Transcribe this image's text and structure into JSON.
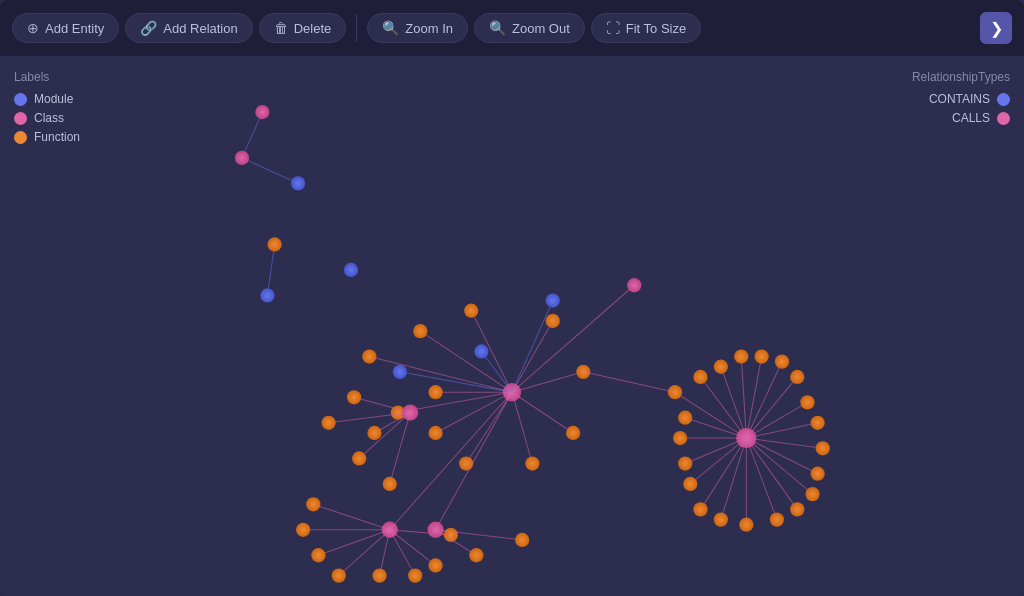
{
  "toolbar": {
    "add_entity_label": "Add Entity",
    "add_relation_label": "Add Relation",
    "delete_label": "Delete",
    "zoom_in_label": "Zoom In",
    "zoom_out_label": "Zoom Out",
    "fit_to_size_label": "Fit To Size",
    "sidebar_toggle_icon": "❯"
  },
  "legend": {
    "labels_title": "Labels",
    "items": [
      {
        "name": "Module",
        "color": "#6677ee"
      },
      {
        "name": "Class",
        "color": "#e066aa"
      },
      {
        "name": "Function",
        "color": "#ee8833"
      }
    ],
    "relation_title": "RelationshipTypes",
    "relations": [
      {
        "name": "CONTAINS",
        "color": "#6677ee"
      },
      {
        "name": "CALLS",
        "color": "#e066aa"
      }
    ]
  },
  "colors": {
    "bg": "#2d2d50",
    "toolbar_bg": "#1e1e38",
    "accent": "#5555aa",
    "node_module": "#6677ee",
    "node_class": "#e066aa",
    "node_function": "#ee8833",
    "edge_contains": "#6677ee",
    "edge_calls": "#e066aa"
  }
}
